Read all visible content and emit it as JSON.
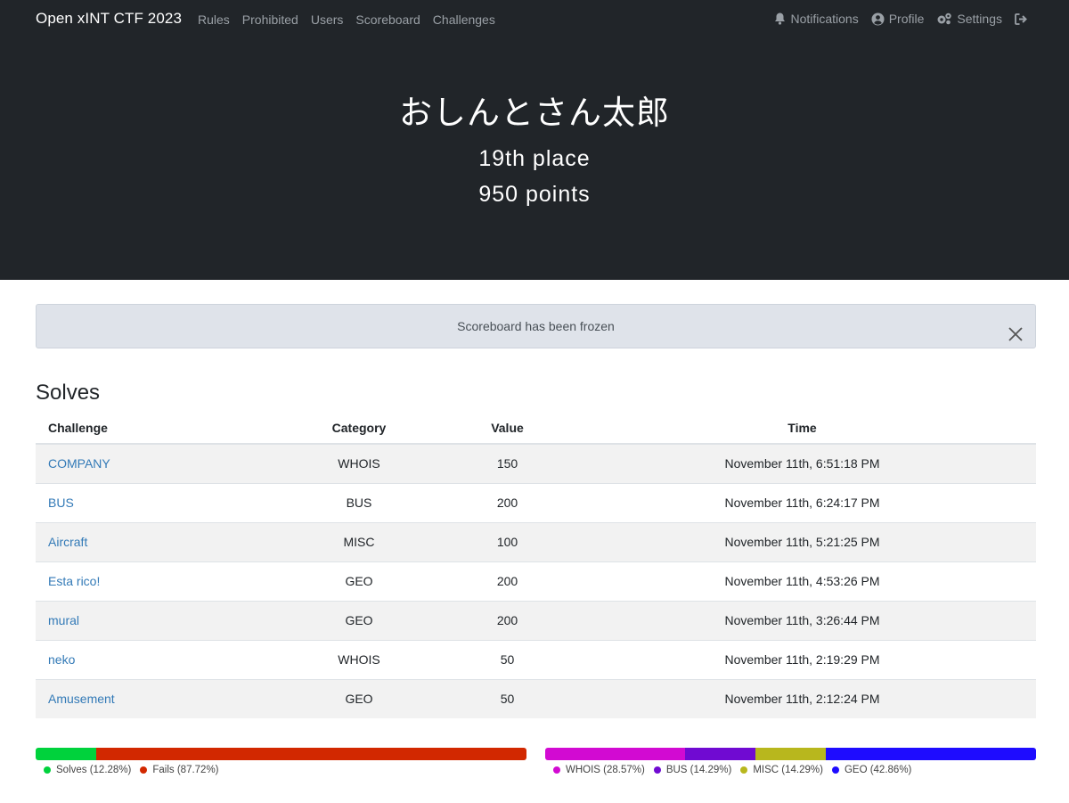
{
  "navbar": {
    "brand": "Open xINT CTF 2023",
    "links": [
      "Rules",
      "Prohibited",
      "Users",
      "Scoreboard",
      "Challenges"
    ],
    "notifications": "Notifications",
    "profile": "Profile",
    "settings": "Settings"
  },
  "hero": {
    "name": "おしんとさん太郎",
    "place": "19th place",
    "points": "950 points"
  },
  "alert": {
    "message": "Scoreboard has been frozen"
  },
  "solves": {
    "title": "Solves",
    "headers": [
      "Challenge",
      "Category",
      "Value",
      "Time"
    ],
    "rows": [
      {
        "challenge": "COMPANY",
        "category": "WHOIS",
        "value": "150",
        "time": "November 11th, 6:51:18 PM"
      },
      {
        "challenge": "BUS",
        "category": "BUS",
        "value": "200",
        "time": "November 11th, 6:24:17 PM"
      },
      {
        "challenge": "Aircraft",
        "category": "MISC",
        "value": "100",
        "time": "November 11th, 5:21:25 PM"
      },
      {
        "challenge": "Esta rico!",
        "category": "GEO",
        "value": "200",
        "time": "November 11th, 4:53:26 PM"
      },
      {
        "challenge": "mural",
        "category": "GEO",
        "value": "200",
        "time": "November 11th, 3:26:44 PM"
      },
      {
        "challenge": "neko",
        "category": "WHOIS",
        "value": "50",
        "time": "November 11th, 2:19:29 PM"
      },
      {
        "challenge": "Amusement",
        "category": "GEO",
        "value": "50",
        "time": "November 11th, 2:12:24 PM"
      }
    ]
  },
  "chart_data": [
    {
      "type": "bar",
      "series": [
        {
          "name": "Solves",
          "value": 12.28,
          "label": "Solves (12.28%)",
          "color": "#00d23c"
        },
        {
          "name": "Fails",
          "value": 87.72,
          "label": "Fails (87.72%)",
          "color": "#d22800"
        }
      ]
    },
    {
      "type": "bar",
      "series": [
        {
          "name": "WHOIS",
          "value": 28.57,
          "label": "WHOIS (28.57%)",
          "color": "#d20ad2"
        },
        {
          "name": "BUS",
          "value": 14.29,
          "label": "BUS (14.29%)",
          "color": "#700ad2"
        },
        {
          "name": "MISC",
          "value": 14.29,
          "label": "MISC (14.29%)",
          "color": "#b8b71d"
        },
        {
          "name": "GEO",
          "value": 42.86,
          "label": "GEO (42.86%)",
          "color": "#1e0cff"
        }
      ]
    }
  ]
}
